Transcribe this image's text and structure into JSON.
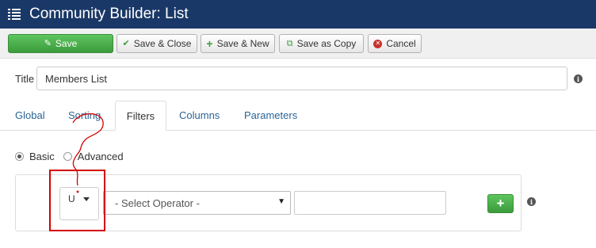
{
  "header": {
    "title": "Community Builder: List",
    "icon": "list-icon"
  },
  "toolbar": {
    "save_label": "Save",
    "save_close_label": "Save & Close",
    "save_new_label": "Save & New",
    "save_copy_label": "Save as Copy",
    "cancel_label": "Cancel",
    "icons": {
      "save": "edit-icon",
      "save_close": "check-icon",
      "save_new": "plus-icon",
      "save_copy": "copy-icon",
      "cancel": "cancel-icon"
    }
  },
  "form": {
    "title_label": "Title",
    "title_value": "Members List"
  },
  "tabs": [
    {
      "label": "Global"
    },
    {
      "label": "Sorting"
    },
    {
      "label": "Filters",
      "active": true
    },
    {
      "label": "Columns"
    },
    {
      "label": "Parameters"
    }
  ],
  "filters": {
    "mode_options": [
      {
        "label": "Basic",
        "selected": true
      },
      {
        "label": "Advanced",
        "selected": false
      }
    ],
    "field_select_value": "U",
    "operator_placeholder": "- Select Operator -",
    "value_input": "",
    "add_button_icon": "plus-icon"
  },
  "colors": {
    "header_bg": "#1a3867",
    "save_green": "#46a546",
    "link_blue": "#2a6496",
    "annotation_red": "#d40000"
  }
}
